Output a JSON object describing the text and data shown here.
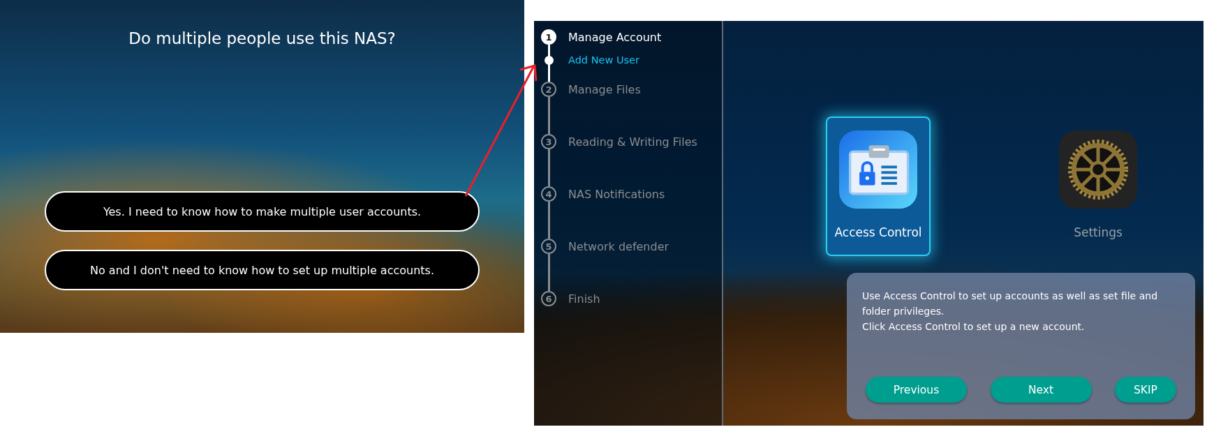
{
  "question_screen": {
    "title": "Do multiple people use this NAS?",
    "options": [
      {
        "label": "Yes. I need to know how to make multiple user accounts."
      },
      {
        "label": "No and I don't need to know how to set up multiple accounts."
      }
    ]
  },
  "tutorial_screen": {
    "steps": [
      {
        "number": "1",
        "label": "Manage Account",
        "active": true,
        "children": [
          {
            "label": "Add New User",
            "selected": true
          }
        ]
      },
      {
        "number": "2",
        "label": "Manage Files",
        "active": false
      },
      {
        "number": "3",
        "label": "Reading & Writing Files",
        "active": false
      },
      {
        "number": "4",
        "label": "NAS Notifications",
        "active": false
      },
      {
        "number": "5",
        "label": "Network defender",
        "active": false
      },
      {
        "number": "6",
        "label": "Finish",
        "active": false
      }
    ],
    "apps": [
      {
        "label": "Access Control",
        "kind": "access",
        "selected": true
      },
      {
        "label": "Settings",
        "kind": "settings",
        "selected": false
      }
    ],
    "tooltip": {
      "paragraphs": [
        "Use Access Control to set up accounts as well as set file and folder privileges.",
        "Click Access Control to set up a new account."
      ],
      "buttons": [
        "Previous",
        "Next",
        "SKIP"
      ]
    }
  }
}
